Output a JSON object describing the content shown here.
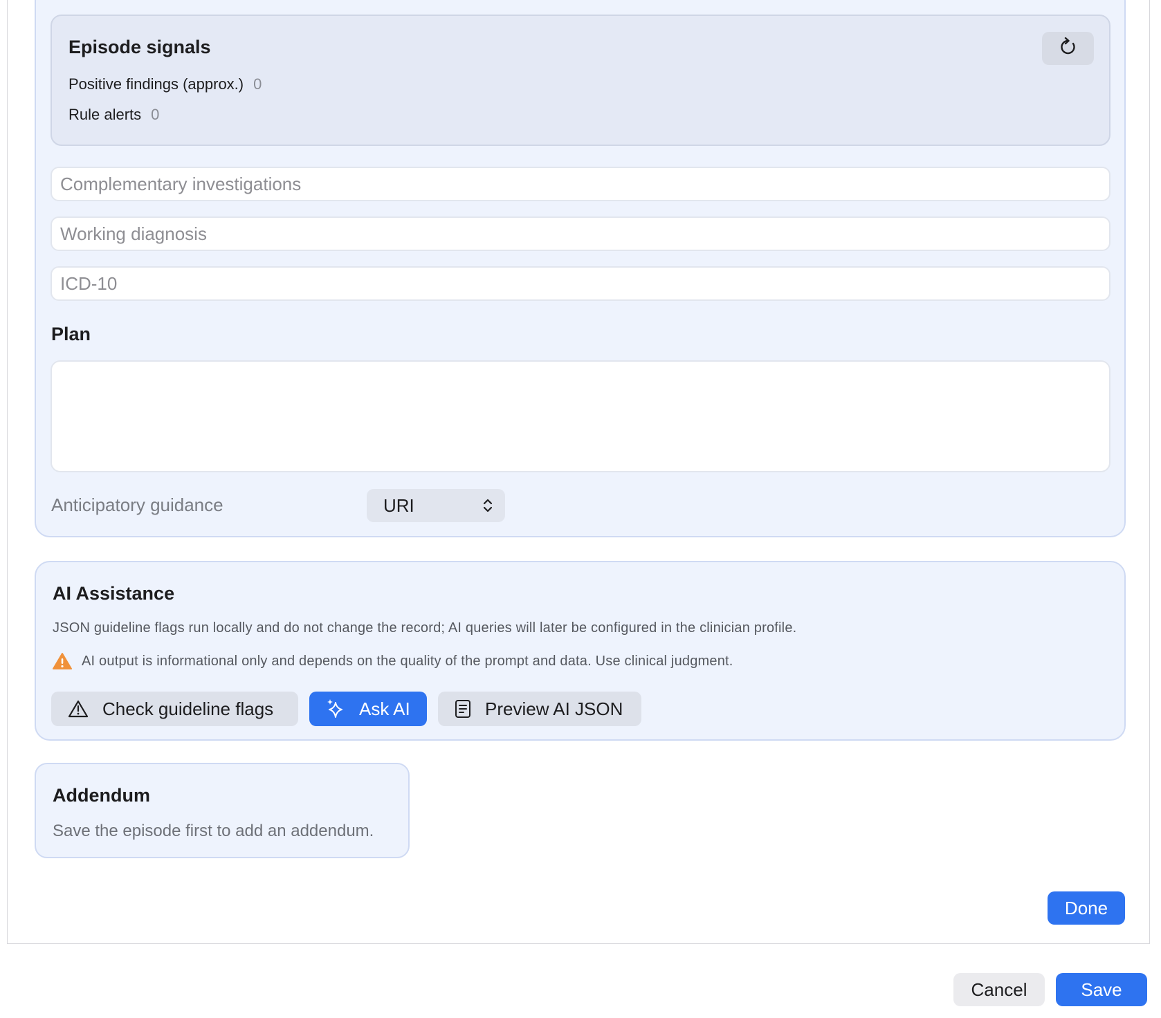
{
  "episode_signals": {
    "title": "Episode signals",
    "rows": [
      {
        "label": "Positive findings (approx.)",
        "value": "0"
      },
      {
        "label": "Rule alerts",
        "value": "0"
      }
    ],
    "refresh_icon": "refresh-icon"
  },
  "fields": {
    "complementary_placeholder": "Complementary investigations",
    "working_diagnosis_placeholder": "Working diagnosis",
    "icd10_placeholder": "ICD-10"
  },
  "plan": {
    "label": "Plan",
    "value": ""
  },
  "anticipatory": {
    "label": "Anticipatory guidance",
    "selected": "URI"
  },
  "ai": {
    "title": "AI Assistance",
    "description": "JSON guideline flags run locally and do not change the record; AI queries will later be configured in the clinician profile.",
    "warning": "AI output is informational only and depends on the quality of the prompt and data. Use clinical judgment.",
    "buttons": {
      "check_flags": "Check guideline flags",
      "ask_ai": "Ask AI",
      "preview_json": "Preview AI JSON"
    }
  },
  "addendum": {
    "title": "Addendum",
    "description": "Save the episode first to add an addendum."
  },
  "actions": {
    "done": "Done",
    "cancel": "Cancel",
    "save": "Save"
  },
  "colors": {
    "accent": "#2e73f0",
    "panel": "#eef3fd",
    "warning": "#f0913a"
  }
}
